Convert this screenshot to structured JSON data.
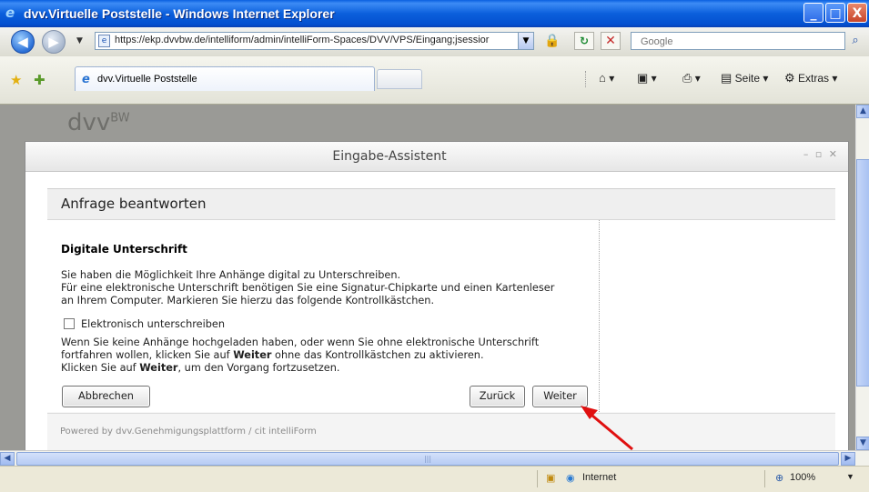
{
  "window": {
    "title": "dvv.Virtuelle Poststelle - Windows Internet Explorer",
    "controls": {
      "minimize": "_",
      "maximize": "□",
      "close": "X"
    }
  },
  "addressbar": {
    "url": "https://ekp.dvvbw.de/intelliform/admin/intelliForm-Spaces/DVV/VPS/Eingang;jsessior",
    "search_placeholder": "Google"
  },
  "tabs": [
    {
      "label": "dvv.Virtuelle Poststelle"
    }
  ],
  "commandbar": {
    "seite": "Seite",
    "extras": "Extras"
  },
  "background": {
    "logo": "dvv",
    "logo_sup": "BW"
  },
  "dialog": {
    "title": "Eingabe-Assistent",
    "panel_title": "Anfrage beantworten",
    "section_heading": "Digitale Unterschrift",
    "paragraph1": [
      "Sie haben die Möglichkeit Ihre Anhänge digital zu Unterschreiben.",
      "Für eine elektronische Unterschrift benötigen Sie eine Signatur-Chipkarte und einen Kartenleser",
      "an Ihrem Computer. Markieren Sie hierzu das folgende Kontrollkästchen."
    ],
    "checkbox_label": "Elektronisch unterschreiben",
    "checkbox_checked": false,
    "paragraph2_line1": "Wenn Sie keine Anhänge hochgeladen haben, oder wenn Sie ohne elektronische Unterschrift",
    "paragraph2_line2_pre": "fortfahren wollen, klicken Sie auf ",
    "paragraph2_line2_bold": "Weiter",
    "paragraph2_line2_post": " ohne das Kontrollkästchen zu aktivieren.",
    "paragraph3_pre": "Klicken Sie auf ",
    "paragraph3_bold": "Weiter",
    "paragraph3_post": ", um den Vorgang fortzusetzen.",
    "buttons": {
      "cancel": "Abbrechen",
      "back": "Zurück",
      "next": "Weiter"
    },
    "footer": "Powered by dvv.Genehmigungsplattform / cit intelliForm"
  },
  "statusbar": {
    "zone": "Internet",
    "zoom": "100%"
  },
  "colors": {
    "titlebar": "#0a5fe0",
    "arrow": "#e01010",
    "dialog_bg": "#ffffff",
    "content_overlay": "#9a9a96"
  }
}
